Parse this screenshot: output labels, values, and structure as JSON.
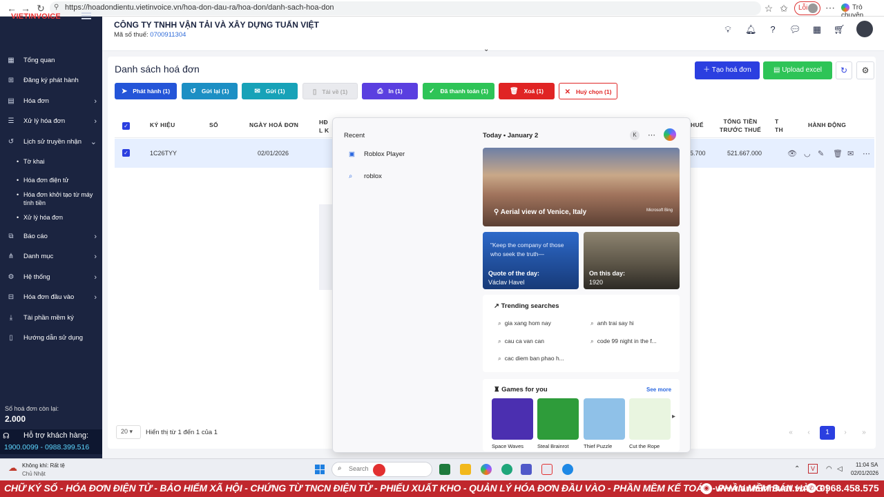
{
  "browser": {
    "url": "https://hoadondientu.vietinvoice.vn/hoa-don-dau-ra/hoa-don/danh-sach-hoa-don",
    "error_label": "Lỗi",
    "copilot_label": "Trò chuyện"
  },
  "sidebar": {
    "logo_main": "VIETINVOICE",
    "items": [
      {
        "label": "Tổng quan",
        "icon": "grid-icon"
      },
      {
        "label": "Đăng ký phát hành",
        "icon": "plus-square-icon"
      },
      {
        "label": "Hóa đơn",
        "icon": "document-icon"
      },
      {
        "label": "Xử lý hóa đơn",
        "icon": "list-icon"
      },
      {
        "label": "Lịch sử truyền nhận",
        "icon": "history-icon"
      },
      {
        "label": "Báo cáo",
        "icon": "report-icon"
      },
      {
        "label": "Danh mục",
        "icon": "tree-icon"
      },
      {
        "label": "Hệ thống",
        "icon": "gear-icon"
      },
      {
        "label": "Hóa đơn đầu vào",
        "icon": "inbox-icon"
      },
      {
        "label": "Tài phần mềm ký",
        "icon": "download-icon"
      },
      {
        "label": "Hướng dẫn sử dụng",
        "icon": "book-icon"
      }
    ],
    "subitems": [
      "Tờ khai",
      "Hóa đơn điện tử",
      "Hóa đơn khởi tạo từ máy tính tiền",
      "Xử lý hóa đơn"
    ],
    "remain_label": "Số hoá đơn còn lại:",
    "remain_value": "2.000",
    "support_label": "Hỗ trợ khách hàng:",
    "support_phones": "1900.0099 - 0988.399.516"
  },
  "header": {
    "company": "CÔNG TY TNHH VẬN TẢI VÀ XÂY DỰNG TUẤN VIỆT",
    "tax_label": "Mã số thuế:",
    "tax_code": "0700911304"
  },
  "page": {
    "title": "Danh sách hoá đơn",
    "create_button": "Tạo hoá đơn",
    "upload_button": "Upload excel"
  },
  "toolbar": [
    {
      "label": "Phát hành (1)",
      "color": "#2455d8",
      "icon": "send-icon"
    },
    {
      "label": "Gửi lại (1)",
      "color": "#1c8fc4",
      "icon": "history-icon"
    },
    {
      "label": "Gửi (1)",
      "color": "#17a2b8",
      "icon": "mail-icon"
    },
    {
      "label": "Tải về (1)",
      "color": "#d9dbe0",
      "icon": "file-icon"
    },
    {
      "label": "In (1)",
      "color": "#5a3fe0",
      "icon": "print-icon"
    },
    {
      "label": "Đã thanh toán (1)",
      "color": "#2ec457",
      "icon": "check-icon"
    },
    {
      "label": "Xoá (1)",
      "color": "#e02424",
      "icon": "trash-icon"
    },
    {
      "label": "Huỷ chọn (1)",
      "color": "#ffffff",
      "icon": "close-icon"
    }
  ],
  "table": {
    "headers": [
      "KÝ HIỆU",
      "SỐ",
      "NGÀY HOÁ ĐƠN",
      "HĐ L K",
      "HUẾ",
      "TỔNG TIỀN TRƯỚC THUẾ",
      "T TH",
      "HÀNH ĐỘNG"
    ],
    "row": {
      "kyhieu": "1C26TYY",
      "so": "",
      "ngay": "02/01/2026",
      "thue": "5.700",
      "tong": "521.667.000"
    }
  },
  "pagination": {
    "page_size": "20",
    "info": "Hiển thị từ 1 đến 1 của 1",
    "current": "1"
  },
  "search_panel": {
    "recent_title": "Recent",
    "recent": [
      {
        "label": "Roblox Player",
        "icon": "app-icon"
      },
      {
        "label": "roblox",
        "icon": "search-icon"
      }
    ],
    "today_label": "Today",
    "today_date": "January 2",
    "avatar_letter": "K",
    "hero_caption": "Aerial view of Venice, Italy",
    "bing_label": "Microsoft Bing",
    "quote_text": "\"Keep the company of those who seek the truth—",
    "quote_label": "Quote of the day:",
    "quote_author": "Václav Havel",
    "onday_label": "On this day:",
    "onday_year": "1920",
    "trending_title": "Trending searches",
    "trending": [
      "gia xang hom nay",
      "anh trai say hi",
      "cau ca van can",
      "code 99 night in the f...",
      "cac diem ban phao h..."
    ],
    "games_title": "Games for you",
    "see_more": "See more",
    "games": [
      {
        "name": "Space Waves",
        "color": "#4b2fb0"
      },
      {
        "name": "Steal Brainrot",
        "color": "#2e9c3a"
      },
      {
        "name": "Thief Puzzle",
        "color": "#8fc1e8"
      },
      {
        "name": "Cut the Rope",
        "color": "#f4f4f4"
      }
    ]
  },
  "taskbar": {
    "weather_line1": "Không khí: Rất tệ",
    "weather_line2": "Chủ Nhật",
    "search_placeholder": "Search",
    "time": "11:04 SA",
    "date": "02/01/2026"
  },
  "banner": {
    "text": "CHỮ KÝ SỐ - HÓA ĐƠN ĐIỆN TỬ - BẢO HIỂM XÃ HỘI - CHỨNG TỪ TNCN ĐIỆN TỬ - PHIẾU XUẤT KHO - QUẢN LÝ HÓA ĐƠN ĐẦU VÀO - PHẦN MỀM KẾ TOÁN - PHẦN MỀM BÁN HÀNG |",
    "site": "www.anminhluat.vn",
    "phone": "0968.458.575"
  }
}
